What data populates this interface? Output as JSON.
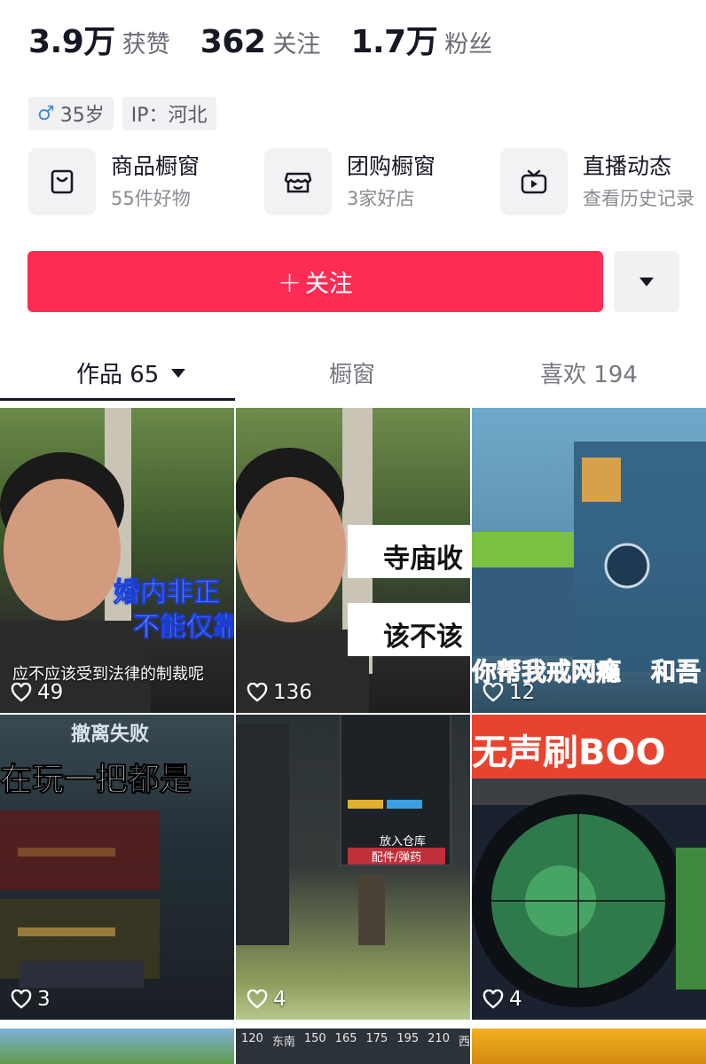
{
  "stats": [
    {
      "value": "3.9万",
      "label": "获赞"
    },
    {
      "value": "362",
      "label": "关注"
    },
    {
      "value": "1.7万",
      "label": "粉丝"
    }
  ],
  "tags": {
    "gender_icon": "male-icon",
    "age": "35岁",
    "ip": "IP：河北"
  },
  "entries": [
    {
      "title": "商品橱窗",
      "subtitle": "55件好物",
      "icon": "shopping-bag-icon"
    },
    {
      "title": "团购橱窗",
      "subtitle": "3家好店",
      "icon": "store-icon"
    },
    {
      "title": "直播动态",
      "subtitle": "查看历史记录",
      "icon": "tv-icon"
    }
  ],
  "follow": {
    "label": "关注",
    "color": "#fe2c55"
  },
  "tabs": [
    {
      "label": "作品 65",
      "active": true
    },
    {
      "label": "橱窗",
      "active": false
    },
    {
      "label": "喜欢 194",
      "active": false
    }
  ],
  "videos": [
    {
      "likes": "49",
      "captions": [
        "婚内非正",
        "不能仅靠",
        "应不应该受到法律的制裁呢"
      ]
    },
    {
      "likes": "136",
      "captions": [
        "寺庙收",
        "该不该"
      ]
    },
    {
      "likes": "12",
      "captions": [
        "你帮我戒网瘾",
        "和吾"
      ]
    },
    {
      "likes": "3",
      "captions": [
        "撤离失败",
        "在玩一把都是"
      ]
    },
    {
      "likes": "4",
      "captions": [
        "放入仓库",
        "配件/弹药"
      ]
    },
    {
      "likes": "4",
      "captions": [
        "无声刷BOO"
      ]
    }
  ],
  "partial_row": {
    "labels": [
      "120",
      "东南",
      "150",
      "165",
      "175",
      "195",
      "210",
      "西南"
    ]
  }
}
